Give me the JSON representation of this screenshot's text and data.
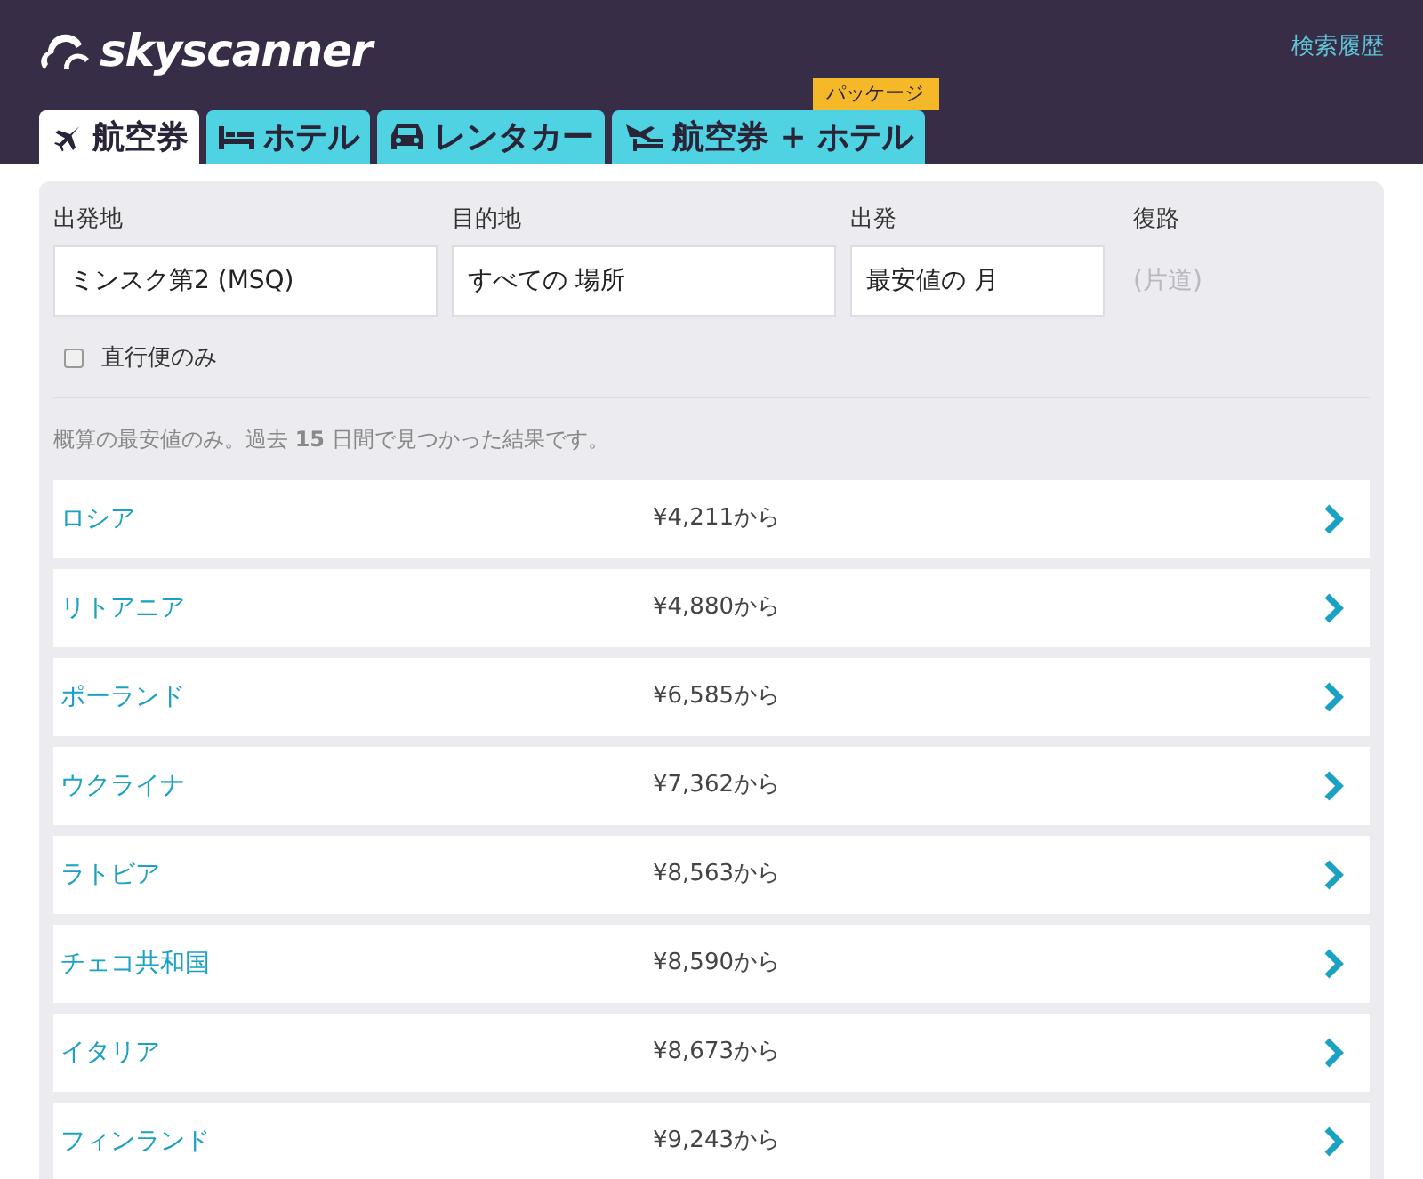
{
  "header": {
    "logo": "skyscanner",
    "history_link": "検索履歴"
  },
  "tabs": [
    {
      "label": "航空券",
      "kind": "flight",
      "selected": true
    },
    {
      "label": "ホテル",
      "kind": "hotel",
      "selected": false
    },
    {
      "label": "レンタカー",
      "kind": "car",
      "selected": false
    },
    {
      "label": "航空券 + ホテル",
      "kind": "package",
      "selected": false,
      "badge": "パッケージ"
    }
  ],
  "form": {
    "fields": [
      {
        "label": "出発地",
        "value": "ミンスク第2 (MSQ)"
      },
      {
        "label": "目的地",
        "value": "すべての 場所"
      },
      {
        "label": "出発",
        "value": "最安値の 月"
      }
    ],
    "return": {
      "label": "復路",
      "value": "(片道)"
    },
    "direct_only": {
      "label": "直行便のみ",
      "checked": false
    },
    "note": "概算の最安値のみ。過去 **15** 日間で見つかった結果です。"
  },
  "results": [
    {
      "country": "ロシア",
      "price": "¥4,211から"
    },
    {
      "country": "リトアニア",
      "price": "¥4,880から"
    },
    {
      "country": "ポーランド",
      "price": "¥6,585から"
    },
    {
      "country": "ウクライナ",
      "price": "¥7,362から"
    },
    {
      "country": "ラトビア",
      "price": "¥8,563から"
    },
    {
      "country": "チェコ共和国",
      "price": "¥8,590から"
    },
    {
      "country": "イタリア",
      "price": "¥8,673から"
    },
    {
      "country": "フィンランド",
      "price": "¥9,243から"
    }
  ]
}
